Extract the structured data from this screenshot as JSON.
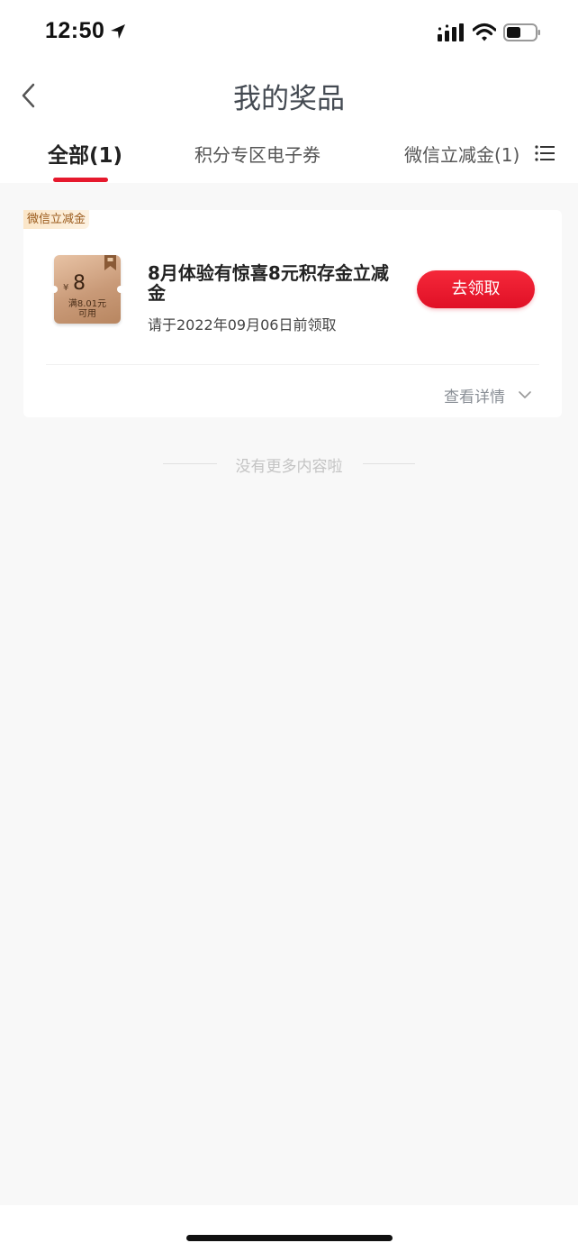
{
  "status_bar": {
    "time": "12:50",
    "icons": [
      "location-arrow-icon",
      "cellular-signal-icon",
      "wifi-icon",
      "battery-icon"
    ]
  },
  "header": {
    "title": "我的奖品",
    "back_icon": "chevron-left-icon"
  },
  "tabs": [
    {
      "label": "全部(1)",
      "active": true
    },
    {
      "label": "积分专区电子券",
      "active": false
    },
    {
      "label": "微信立减金(1)",
      "active": false
    }
  ],
  "menu_icon": "list-icon",
  "prize_card": {
    "tag": "微信立减金",
    "coupon": {
      "currency": "¥",
      "amount": "8",
      "condition_line1": "满8.01元",
      "condition_line2": "可用"
    },
    "title": "8月体验有惊喜8元积存金立减金",
    "deadline": "请于2022年09月06日前领取",
    "claim_label": "去领取",
    "details_label": "查看详情"
  },
  "end_of_list": "没有更多内容啦",
  "colors": {
    "accent": "#e6192d",
    "coupon_gold": "#c99a78",
    "tag_text": "#9a5a1c"
  }
}
